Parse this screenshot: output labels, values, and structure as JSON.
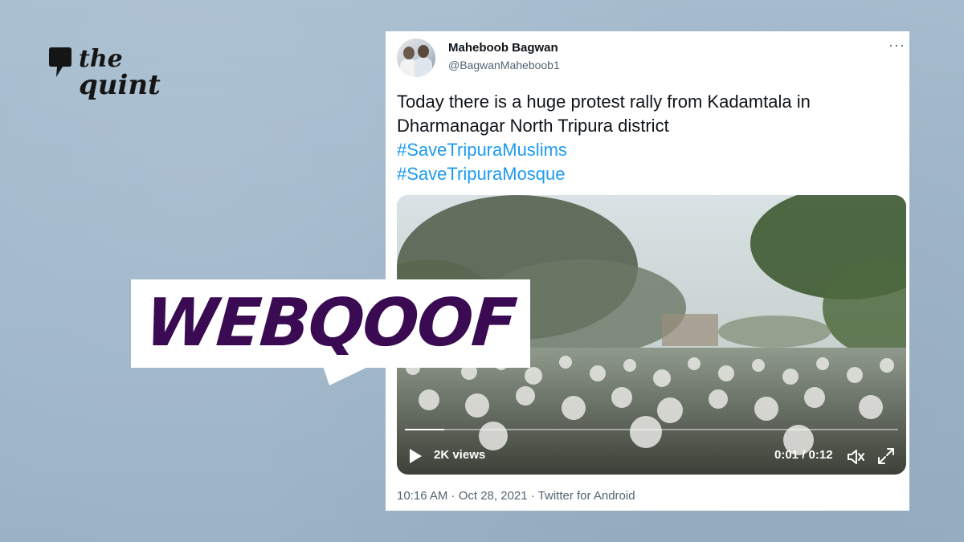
{
  "brand": {
    "line1": "the",
    "line2": "quint"
  },
  "label": {
    "text": "WEBQOOF",
    "color": "#3a0a52"
  },
  "tweet": {
    "name": "Maheboob Bagwan",
    "handle": "@BagwanMaheboob1",
    "more": "···",
    "text_line1": "Today there is a huge protest rally from Kadamtala in",
    "text_line2": "Dharmanagar North Tripura district",
    "hashtag1": "#SaveTripuraMuslims",
    "hashtag2": "#SaveTripuraMosque",
    "hashtag_color": "#1d9bf0",
    "video": {
      "views": "2K views",
      "time": "0:01 / 0:12",
      "progress": 0.08
    },
    "meta": "10:16 AM · Oct 28, 2021 · Twitter for Android"
  }
}
